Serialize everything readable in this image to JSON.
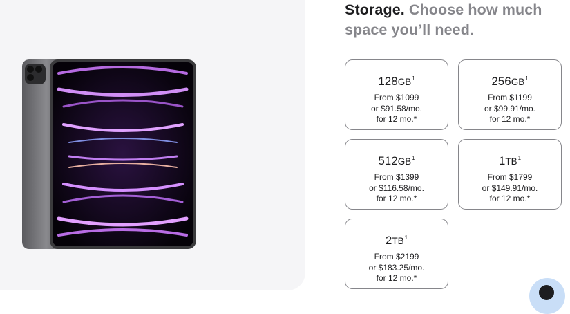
{
  "heading": {
    "lead": "Storage.",
    "rest": "Choose how much space you’ll need."
  },
  "product_image": {
    "alt": "iPad Pro space gray",
    "icon": "ipad-image"
  },
  "storage_options": [
    {
      "capacity": "128",
      "unit": "GB",
      "footnote": "1",
      "price": "From $1099",
      "monthly": "or $91.58/mo.",
      "term": "for 12 mo.*"
    },
    {
      "capacity": "256",
      "unit": "GB",
      "footnote": "1",
      "price": "From $1199",
      "monthly": "or $99.91/mo.",
      "term": "for 12 mo.*"
    },
    {
      "capacity": "512",
      "unit": "GB",
      "footnote": "1",
      "price": "From $1399",
      "monthly": "or $116.58/mo.",
      "term": "for 12 mo.*"
    },
    {
      "capacity": "1",
      "unit": "TB",
      "footnote": "1",
      "price": "From $1799",
      "monthly": "or $149.91/mo.",
      "term": "for 12 mo.*"
    },
    {
      "capacity": "2",
      "unit": "TB",
      "footnote": "1",
      "price": "From $2199",
      "monthly": "or $183.25/mo.",
      "term": "for 12 mo.*"
    }
  ],
  "chat_button": {
    "icon": "chat-avatar-icon"
  },
  "colors": {
    "text": "#1d1d1f",
    "muted": "#86868b",
    "panel": "#f5f5f7",
    "border": "#86868b"
  }
}
